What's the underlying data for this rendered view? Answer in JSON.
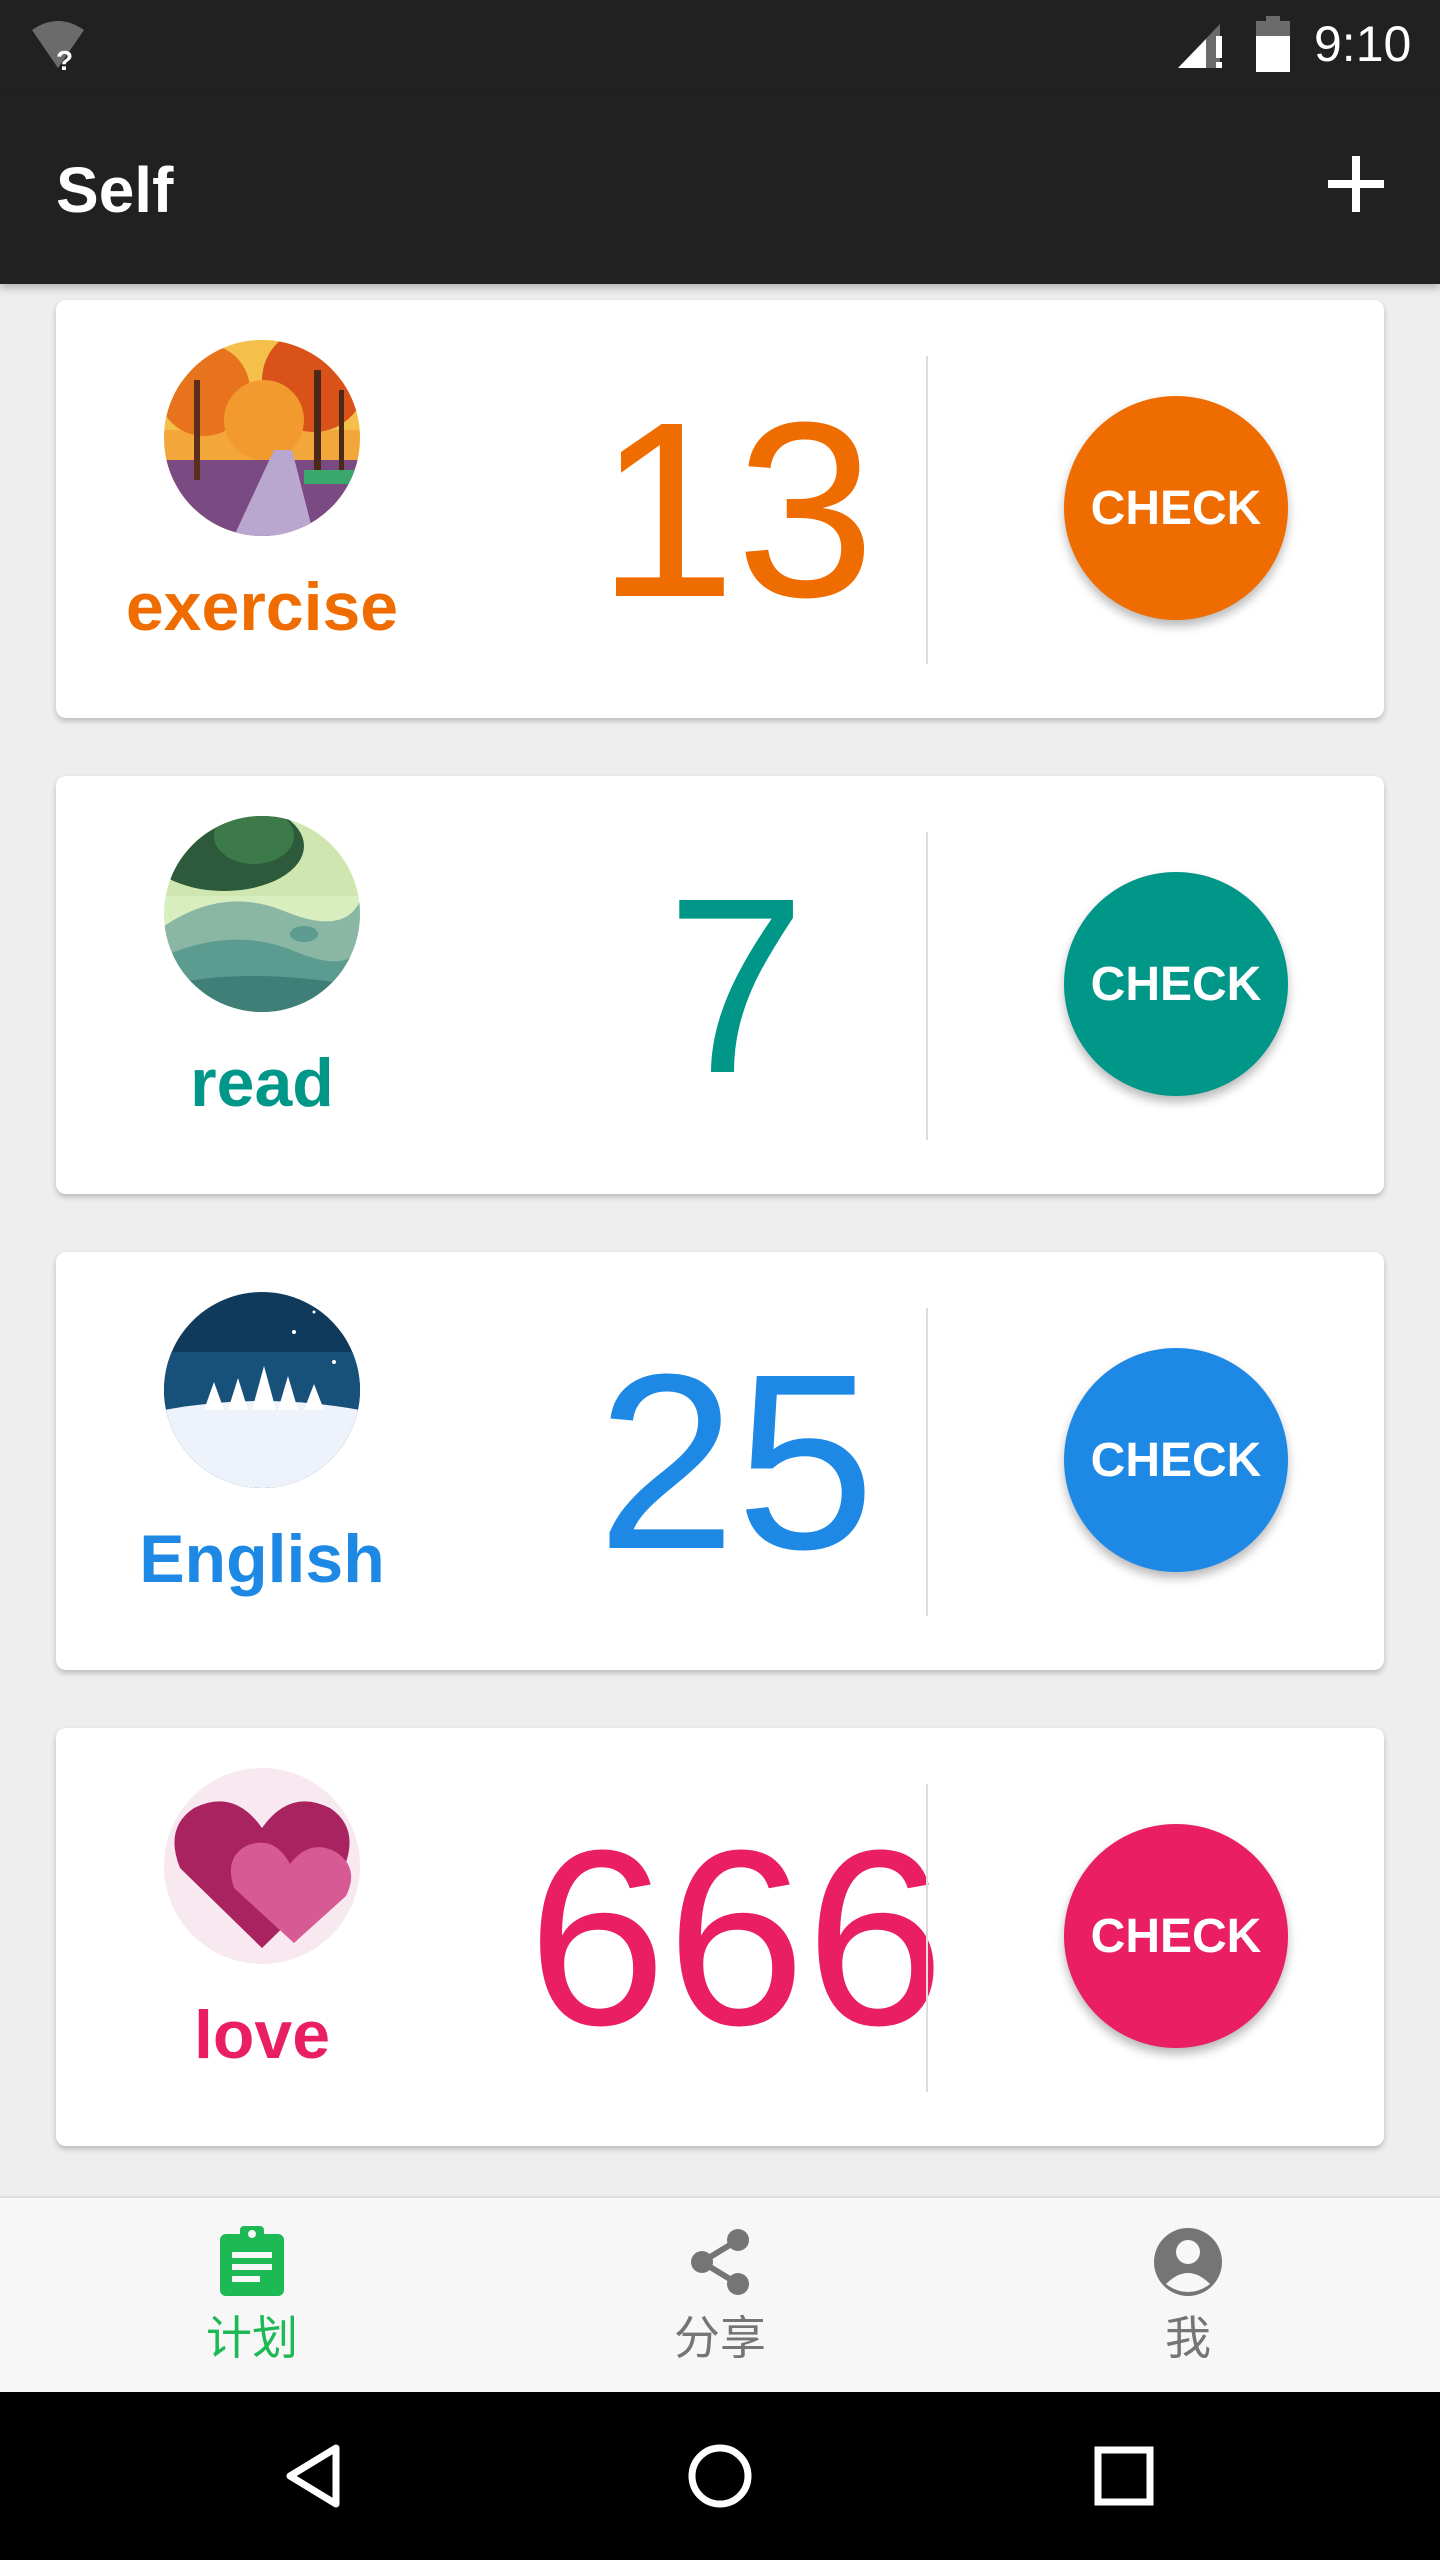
{
  "status_bar": {
    "time": "9:10",
    "wifi_icon": "wifi-unknown-icon",
    "signal_icon": "cell-signal-alert-icon",
    "battery_icon": "battery-icon"
  },
  "app_bar": {
    "title": "Self",
    "add_icon": "plus-icon"
  },
  "habits": [
    {
      "name": "exercise",
      "count": "13",
      "check_label": "CHECK",
      "color": "#EF6C00",
      "image": "autumn-forest-path"
    },
    {
      "name": "read",
      "count": "7",
      "check_label": "CHECK",
      "color": "#009688",
      "image": "green-hills"
    },
    {
      "name": "English",
      "count": "25",
      "check_label": "CHECK",
      "color": "#1E88E5",
      "image": "snowy-pine-night"
    },
    {
      "name": "love",
      "count": "666",
      "check_label": "CHECK",
      "color": "#E91E63",
      "image": "pink-hearts"
    }
  ],
  "bottom_nav": {
    "items": [
      {
        "label": "计划",
        "icon": "clipboard-icon",
        "active": true,
        "color": "#1DB954"
      },
      {
        "label": "分享",
        "icon": "share-icon",
        "active": false,
        "color": "#757575"
      },
      {
        "label": "我",
        "icon": "account-circle-icon",
        "active": false,
        "color": "#757575"
      }
    ]
  },
  "system_nav": {
    "back_icon": "back-triangle-icon",
    "home_icon": "home-circle-icon",
    "recents_icon": "recents-square-icon"
  }
}
